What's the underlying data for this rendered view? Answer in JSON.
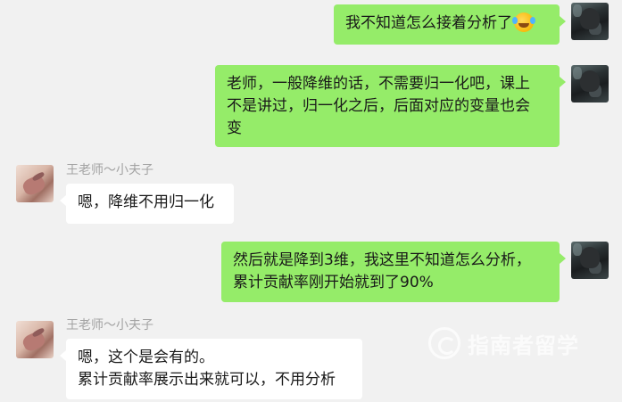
{
  "messages": [
    {
      "sender": "me",
      "lines": [
        "我不知道怎么接着分析了"
      ],
      "emoji": "face-with-tears-of-joy"
    },
    {
      "sender": "me",
      "lines": [
        "老师，一般降维的话，不需要归一化吧，课上",
        "不是讲过，归一化之后，后面对应的变量也会",
        "变"
      ]
    },
    {
      "sender": "teacher",
      "name": "王老师～小夫子",
      "lines": [
        "嗯，降维不用归一化"
      ]
    },
    {
      "sender": "me",
      "lines": [
        "然后就是降到3维，我这里不知道怎么分析，",
        "累计贡献率刚开始就到了90%"
      ]
    },
    {
      "sender": "teacher",
      "name": "王老师～小夫子",
      "lines": [
        "嗯，这个是会有的。",
        "累计贡献率展示出来就可以，不用分析"
      ]
    }
  ],
  "watermark": {
    "text": "指南者留学"
  },
  "colors": {
    "background": "#f1f1f1",
    "my_bubble": "#95ec69",
    "their_bubble": "#ffffff",
    "name_text": "#a3a3a3"
  }
}
